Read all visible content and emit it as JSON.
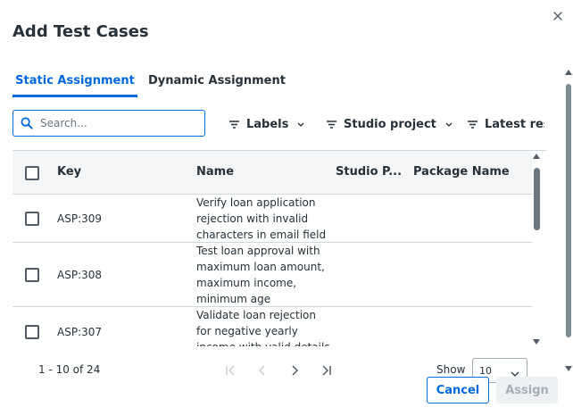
{
  "dialog": {
    "title": "Add Test Cases",
    "close_icon": "close-icon"
  },
  "tabs": [
    {
      "label": "Static Assignment",
      "active": true
    },
    {
      "label": "Dynamic Assignment",
      "active": false
    }
  ],
  "search": {
    "placeholder": "Search...",
    "value": "",
    "icon": "search-icon"
  },
  "filters": {
    "labels": "Labels",
    "studio_project": "Studio project",
    "latest_result": "Latest resu"
  },
  "table": {
    "headers": {
      "key": "Key",
      "name": "Name",
      "studio_project": "Studio P...",
      "package_name": "Package Name"
    },
    "rows": [
      {
        "key": "ASP:309",
        "name": "Verify loan application rejection with invalid characters in email field"
      },
      {
        "key": "ASP:308",
        "name": "Test loan approval with maximum loan amount, maximum income, minimum age"
      },
      {
        "key": "ASP:307",
        "name": "Validate loan rejection for negative yearly income with valid details"
      }
    ]
  },
  "pagination": {
    "range": "1 - 10 of 24",
    "show_label": "Show",
    "page_size": "10"
  },
  "footer": {
    "cancel_label": "Cancel",
    "assign_label": "Assign"
  },
  "colors": {
    "accent": "#0067df",
    "text": "#273139",
    "border": "#cfd8dd",
    "disabled_bg": "#eef1f3",
    "disabled_text": "#a4b1b8"
  }
}
